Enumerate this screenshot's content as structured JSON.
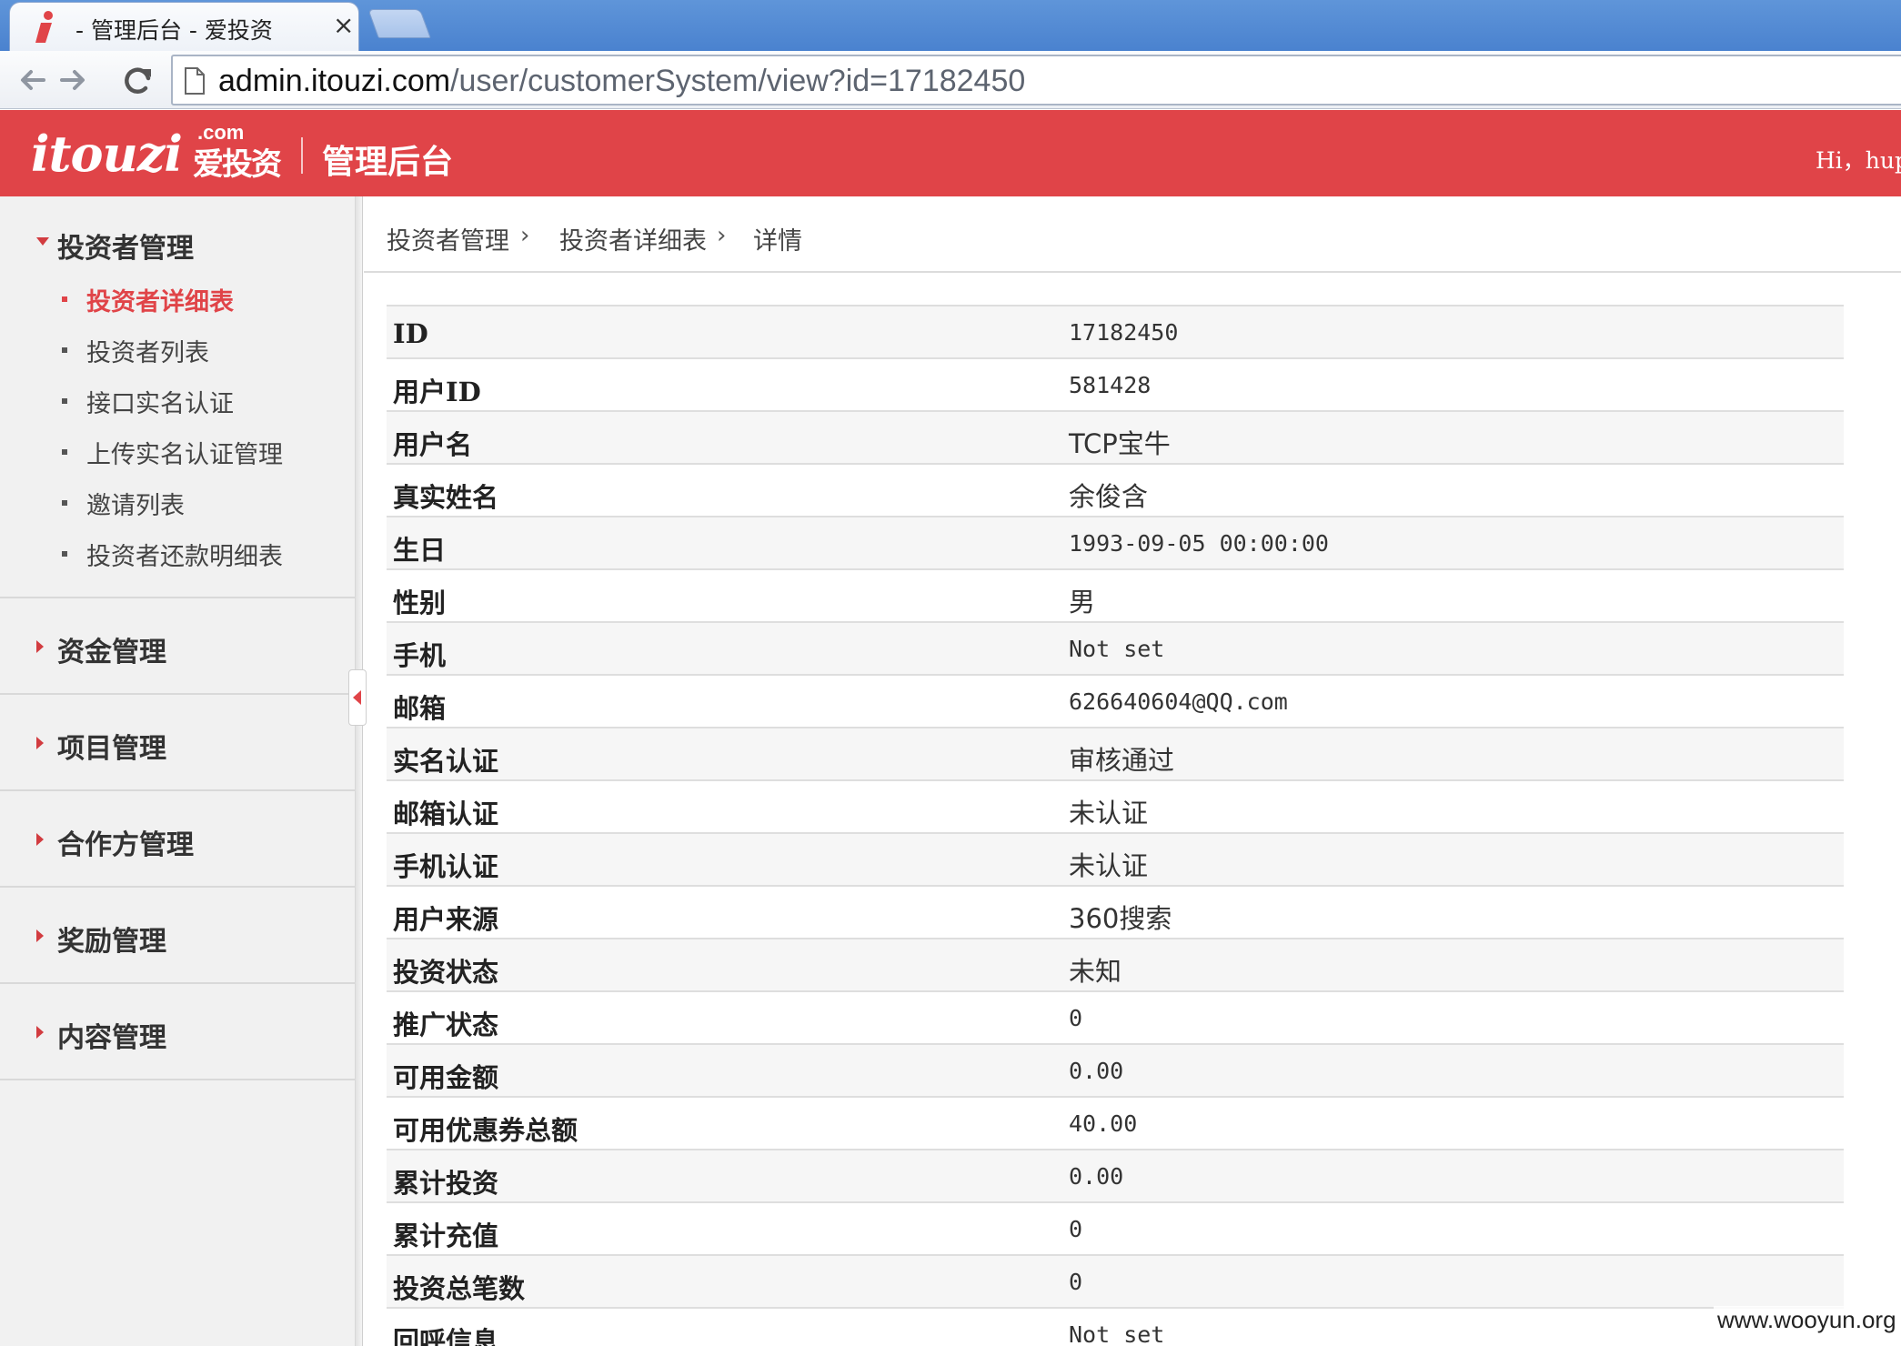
{
  "browser": {
    "tab_title": "- 管理后台 - 爱投资",
    "tab_close": "×",
    "url_host": "admin.itouzi.com",
    "url_path": "/user/customerSystem/view?id=17182450"
  },
  "header": {
    "logo_word": "itouzi",
    "logo_com": ".com",
    "logo_cn": "爱投资",
    "title": "管理后台",
    "user_greeting": "Hi，hup"
  },
  "sidebar": {
    "groups": [
      {
        "label": "投资者管理",
        "expanded": true,
        "items": [
          {
            "label": "投资者详细表",
            "active": true
          },
          {
            "label": "投资者列表"
          },
          {
            "label": "接口实名认证"
          },
          {
            "label": "上传实名认证管理"
          },
          {
            "label": "邀请列表"
          },
          {
            "label": "投资者还款明细表"
          }
        ]
      },
      {
        "label": "资金管理"
      },
      {
        "label": "项目管理"
      },
      {
        "label": "合作方管理"
      },
      {
        "label": "奖励管理"
      },
      {
        "label": "内容管理"
      }
    ]
  },
  "breadcrumb": [
    "投资者管理",
    "投资者详细表",
    "详情"
  ],
  "breadcrumb_separator": "›",
  "details": [
    {
      "label": "ID",
      "value": "17182450"
    },
    {
      "label": "用户ID",
      "value": "581428"
    },
    {
      "label": "用户名",
      "value": "TCP宝牛"
    },
    {
      "label": "真实姓名",
      "value": "余俊含"
    },
    {
      "label": "生日",
      "value": "1993-09-05 00:00:00"
    },
    {
      "label": "性别",
      "value": "男"
    },
    {
      "label": "手机",
      "value": "Not set"
    },
    {
      "label": "邮箱",
      "value": "626640604@QQ.com"
    },
    {
      "label": "实名认证",
      "value": "审核通过"
    },
    {
      "label": "邮箱认证",
      "value": "未认证"
    },
    {
      "label": "手机认证",
      "value": "未认证"
    },
    {
      "label": "用户来源",
      "value": "360搜索"
    },
    {
      "label": "投资状态",
      "value": "未知"
    },
    {
      "label": "推广状态",
      "value": "0"
    },
    {
      "label": "可用金额",
      "value": "0.00"
    },
    {
      "label": "可用优惠券总额",
      "value": "40.00"
    },
    {
      "label": "累计投资",
      "value": "0.00"
    },
    {
      "label": "累计充值",
      "value": "0"
    },
    {
      "label": "投资总笔数",
      "value": "0"
    },
    {
      "label": "回呼信息",
      "value": "Not set"
    }
  ],
  "watermark": "www.wooyun.org",
  "colors": {
    "brand_red": "#e04448",
    "chrome_blue": "#4a82cf"
  }
}
